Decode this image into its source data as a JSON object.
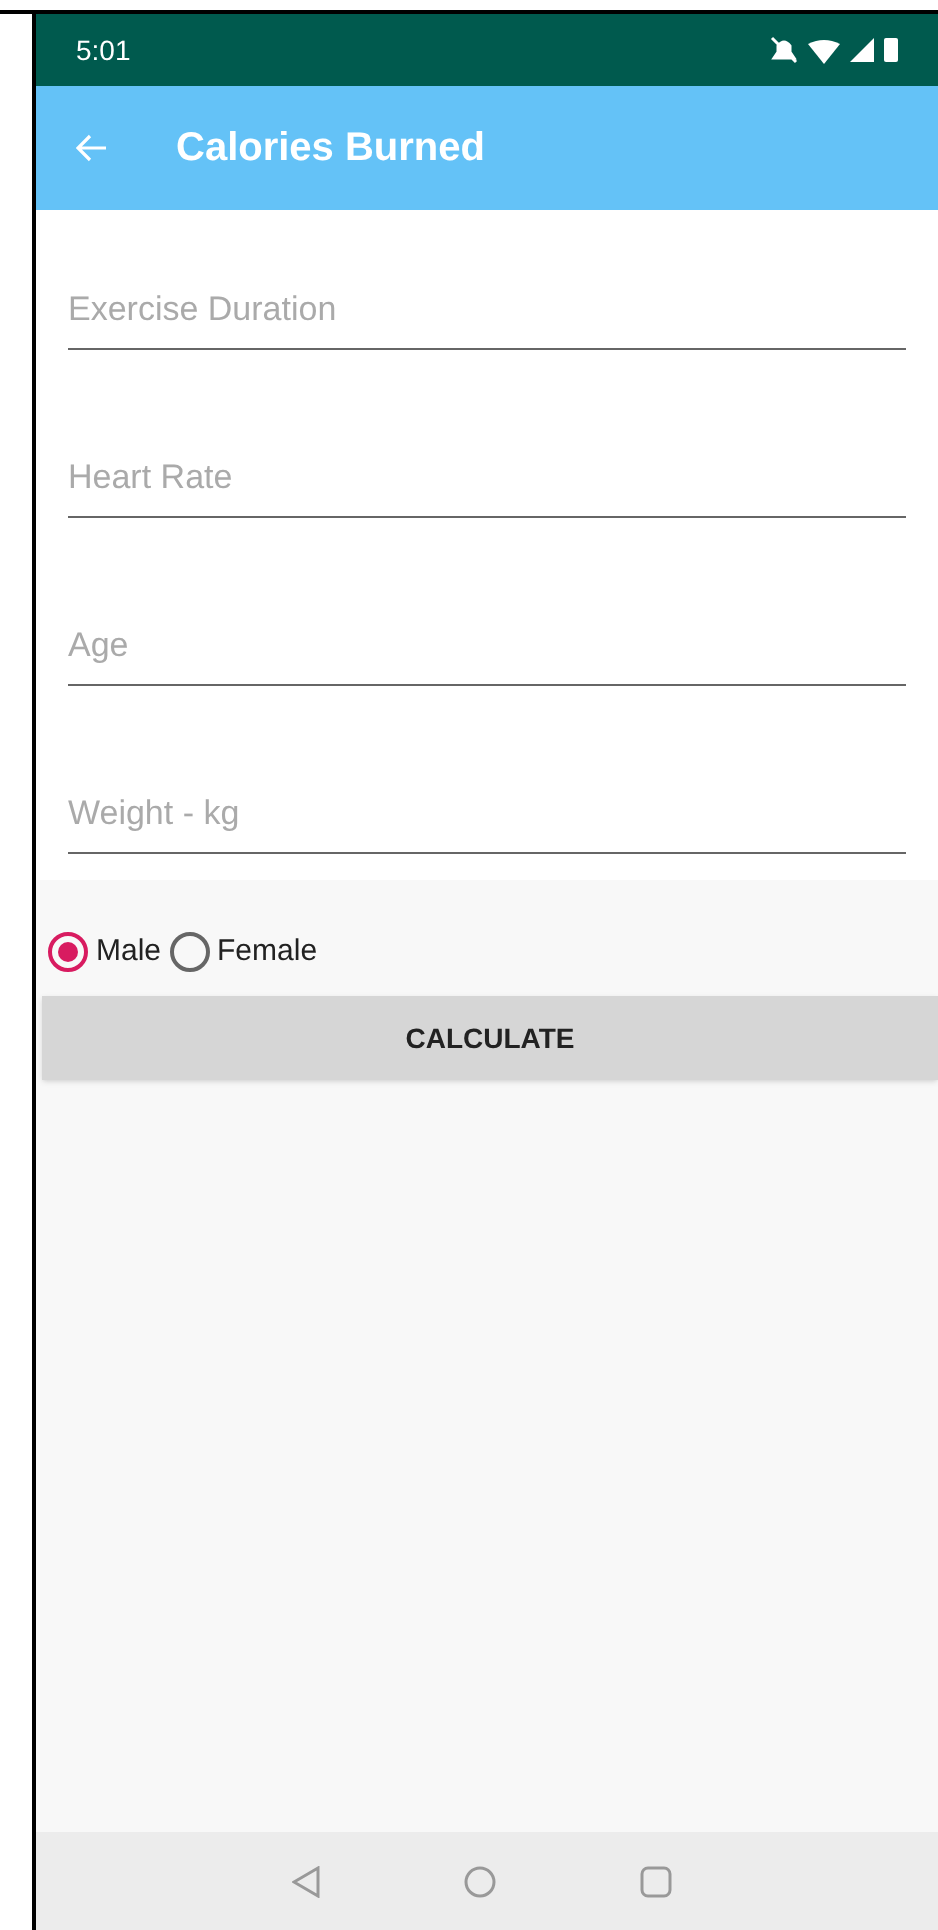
{
  "status_bar": {
    "time": "5:01"
  },
  "app_bar": {
    "title": "Calories Burned"
  },
  "fields": [
    {
      "placeholder": "Exercise Duration"
    },
    {
      "placeholder": "Heart Rate"
    },
    {
      "placeholder": "Age"
    },
    {
      "placeholder": "Weight - kg"
    }
  ],
  "gender": [
    {
      "label": "Male",
      "selected": true
    },
    {
      "label": "Female",
      "selected": false
    }
  ],
  "button": "CALCULATE"
}
